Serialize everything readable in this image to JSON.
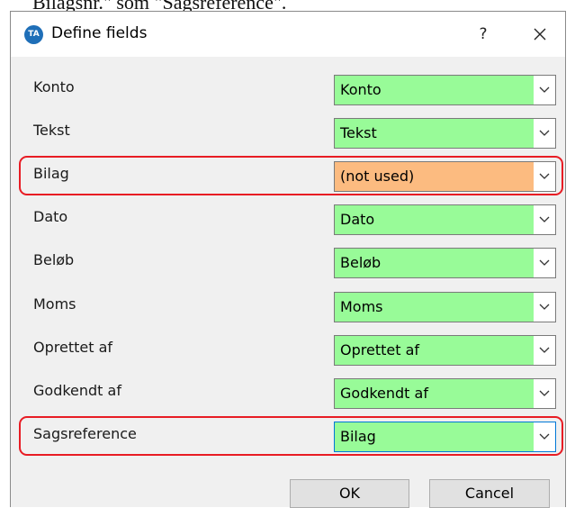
{
  "caption": "Bilagsnr.\" som \"Sagsreference\".",
  "dialog": {
    "app_icon_text": "TA",
    "title": "Define fields",
    "help_label": "?",
    "rows": [
      {
        "label": "Konto",
        "value": "Konto",
        "state": "mapped"
      },
      {
        "label": "Tekst",
        "value": "Tekst",
        "state": "mapped"
      },
      {
        "label": "Bilag",
        "value": "(not used)",
        "state": "unused",
        "highlighted": true
      },
      {
        "label": "Dato",
        "value": "Dato",
        "state": "mapped"
      },
      {
        "label": "Beløb",
        "value": "Beløb",
        "state": "mapped"
      },
      {
        "label": "Moms",
        "value": "Moms",
        "state": "mapped"
      },
      {
        "label": "Oprettet af",
        "value": "Oprettet af",
        "state": "mapped"
      },
      {
        "label": "Godkendt af",
        "value": "Godkendt af",
        "state": "mapped"
      },
      {
        "label": "Sagsreference",
        "value": "Bilag",
        "state": "mapped",
        "highlighted": true,
        "focused": true
      }
    ],
    "ok_label": "OK",
    "cancel_label": "Cancel"
  },
  "colors": {
    "mapped": "#98fb98",
    "unused": "#fcbb80",
    "highlight": "#e81c24",
    "app_icon": "#1f6fb8"
  }
}
